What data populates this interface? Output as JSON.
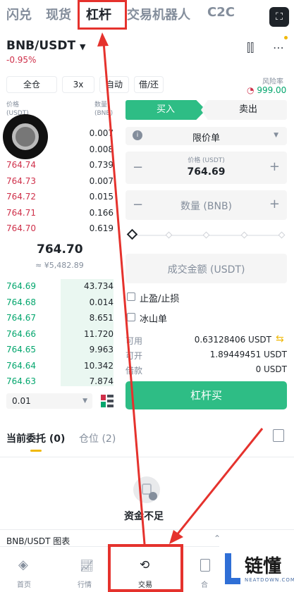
{
  "top_tabs": [
    "闪兑",
    "现货",
    "杠杆",
    "交易机器人",
    "C2C"
  ],
  "pair": "BNB/USDT",
  "change": "-0.95%",
  "margin_mode": "全仓",
  "leverage": "3x",
  "auto": "自动",
  "borrow_repay": "借/还",
  "risk_label": "风险率",
  "risk_value": "999.00",
  "ob_price_header": "价格 (USDT)",
  "ob_qty_header": "数量 (BNB)",
  "asks": [
    {
      "p": "",
      "q": "0.007"
    },
    {
      "p": "",
      "q": "0.008"
    },
    {
      "p": "764.74",
      "q": "0.739"
    },
    {
      "p": "764.73",
      "q": "0.007"
    },
    {
      "p": "764.72",
      "q": "0.015"
    },
    {
      "p": "764.71",
      "q": "0.166"
    },
    {
      "p": "764.70",
      "q": "0.619"
    }
  ],
  "mid_price": "764.70",
  "mid_fiat": "≈ ¥5,482.89",
  "bids": [
    {
      "p": "764.69",
      "q": "43.734"
    },
    {
      "p": "764.68",
      "q": "0.014"
    },
    {
      "p": "764.67",
      "q": "8.651"
    },
    {
      "p": "764.66",
      "q": "11.720"
    },
    {
      "p": "764.65",
      "q": "9.963"
    },
    {
      "p": "764.64",
      "q": "10.342"
    },
    {
      "p": "764.63",
      "q": "7.874"
    }
  ],
  "tick_size": "0.01",
  "buy_tab": "买入",
  "sell_tab": "卖出",
  "order_type": "限价单",
  "price_label": "价格 (USDT)",
  "price_value": "764.69",
  "qty_placeholder": "数量 (BNB)",
  "amount_placeholder": "成交金额 (USDT)",
  "tp_sl": "止盈/止损",
  "iceberg": "冰山单",
  "available_label": "可用",
  "available_value": "0.63128406 USDT",
  "max_open_label": "可开",
  "max_open_value": "1.89449451 USDT",
  "borrow_label": "借款",
  "borrow_value": "0 USDT",
  "submit": "杠杆买",
  "orders_tab": "当前委托 (0)",
  "positions_tab": "仓位 (2)",
  "empty_text": "资金不足",
  "chart_bar": "BNB/USDT 图表",
  "bottom_nav": [
    "首页",
    "行情",
    "交易",
    "合"
  ],
  "watermark": {
    "brand": "链懂",
    "site": "NEATDOWN.COM"
  }
}
